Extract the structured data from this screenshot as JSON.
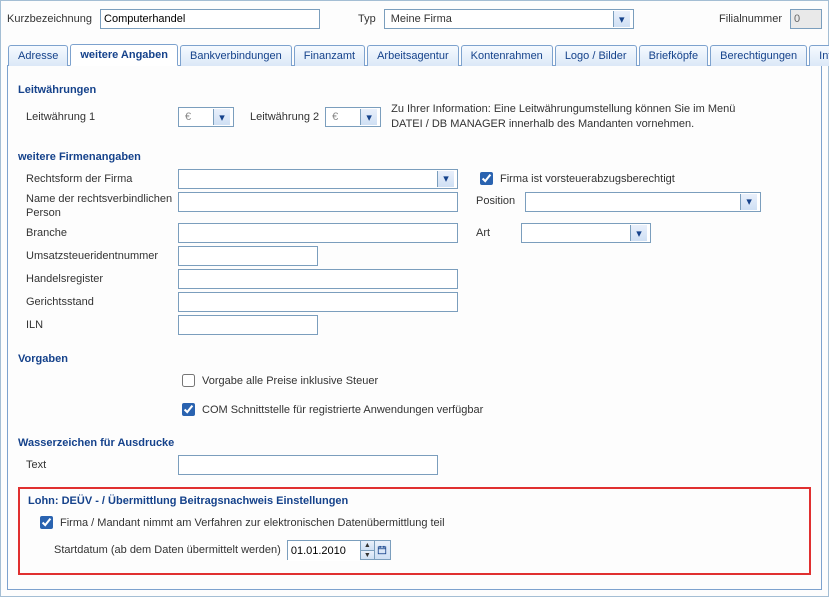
{
  "header": {
    "kurzbezeichnung_label": "Kurzbezeichnung",
    "kurzbezeichnung_value": "Computerhandel",
    "typ_label": "Typ",
    "typ_value": "Meine Firma",
    "filialnummer_label": "Filialnummer",
    "filialnummer_value": "0"
  },
  "tabs": {
    "adresse": "Adresse",
    "weitere": "weitere Angaben",
    "bank": "Bankverbindungen",
    "finanzamt": "Finanzamt",
    "arbeitsagentur": "Arbeitsagentur",
    "kontenrahmen": "Kontenrahmen",
    "logo": "Logo / Bilder",
    "briefkoepfe": "Briefköpfe",
    "berechtigungen": "Berechtigungen",
    "info": "Info"
  },
  "leitwaehrungen": {
    "title": "Leitwährungen",
    "lw1_label": "Leitwährung 1",
    "lw1_value": "€",
    "lw2_label": "Leitwährung 2",
    "lw2_value": "€",
    "info_text": "Zu Ihrer Information: Eine  Leitwährungumstellung können Sie im Menü DATEI / DB MANAGER innerhalb des Mandanten vornehmen."
  },
  "firmenangaben": {
    "title": "weitere Firmenangaben",
    "rechtsform_label": "Rechtsform der Firma",
    "rechtsform_value": "",
    "vorsteuer_label": "Firma ist vorsteuerabzugsberechtigt",
    "name_label": "Name der rechtsverbindlichen Person",
    "name_value": "",
    "position_label": "Position",
    "position_value": "",
    "branche_label": "Branche",
    "branche_value": "",
    "art_label": "Art",
    "art_value": "",
    "ust_label": "Umsatzsteueridentnummer",
    "ust_value": "",
    "handelsregister_label": "Handelsregister",
    "handelsregister_value": "",
    "gericht_label": "Gerichtsstand",
    "gericht_value": "",
    "iln_label": "ILN",
    "iln_value": ""
  },
  "vorgaben": {
    "title": "Vorgaben",
    "preise_label": "Vorgabe alle Preise inklusive Steuer",
    "com_label": "COM Schnittstelle für registrierte Anwendungen verfügbar"
  },
  "wasserzeichen": {
    "title": "Wasserzeichen für Ausdrucke",
    "text_label": "Text",
    "text_value": ""
  },
  "lohn": {
    "title": "Lohn: DEÜV - / Übermittlung Beitragsnachweis Einstellungen",
    "verfahren_label": "Firma / Mandant nimmt am Verfahren zur elektronischen Datenübermittlung teil",
    "startdatum_label": "Startdatum (ab dem Daten übermittelt werden)",
    "startdatum_value": "01.01.2010"
  }
}
